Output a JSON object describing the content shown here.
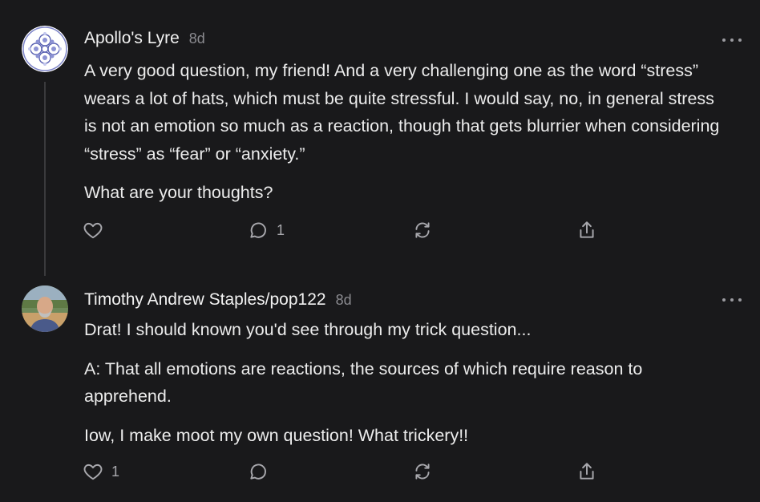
{
  "comments": [
    {
      "author": "Apollo's Lyre",
      "time": "8d",
      "paragraphs": [
        "A very good question, my friend! And a very challenging one as the word “stress” wears a lot of hats, which must be quite stressful. I would say, no, in general stress is not an emotion so much as a reaction, though that gets blurrier when considering “stress” as “fear” or “anxiety.”",
        "What are your thoughts?"
      ],
      "like_count": "",
      "reply_count": "1",
      "avatar_icon": "fractal-circle-avatar"
    },
    {
      "author": "Timothy Andrew Staples/pop122",
      "time": "8d",
      "paragraphs": [
        "Drat! I should known you'd see through my trick question...",
        "A: That all emotions are reactions, the sources of which require reason to apprehend.",
        "Iow, I make moot my own question! What trickery!!"
      ],
      "like_count": "1",
      "reply_count": "",
      "avatar_icon": "photo-avatar"
    }
  ],
  "icons": {
    "like": "heart-icon",
    "reply": "comment-bubble-icon",
    "restack": "restack-icon",
    "share": "share-icon",
    "more": "more-dots-icon"
  },
  "colors": {
    "background": "#19191b",
    "text": "#ececec",
    "muted": "#8b8b90",
    "thread_line": "#3a3a3d"
  }
}
